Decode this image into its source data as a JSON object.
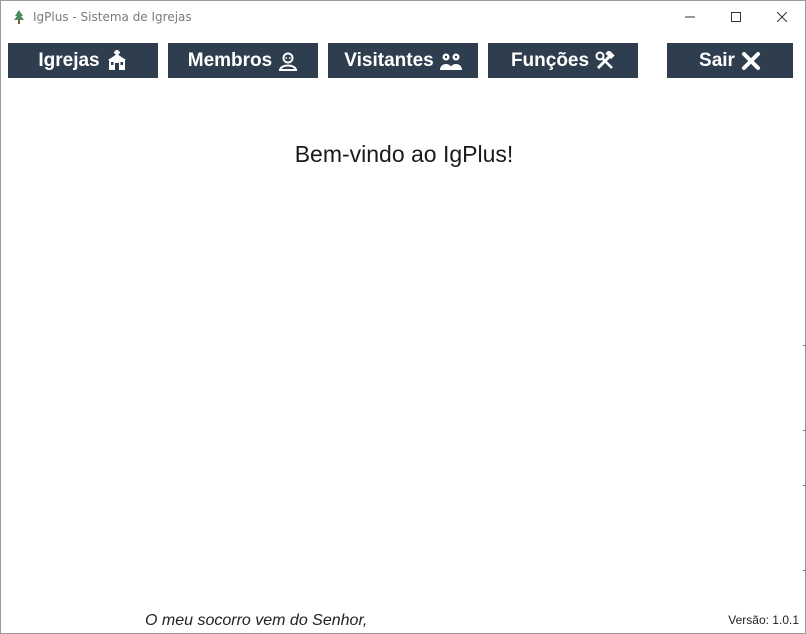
{
  "window": {
    "title": "IgPlus - Sistema de Igrejas",
    "app_icon": "tree-icon",
    "controls": [
      "minimize-icon",
      "maximize-icon",
      "close-icon"
    ]
  },
  "toolbar": {
    "igrejas_label": "Igrejas",
    "igrejas_icon": "church-icon",
    "membros_label": "Membros",
    "membros_icon": "person-icon",
    "visitantes_label": "Visitantes",
    "visitantes_icon": "people-icon",
    "funcoes_label": "Funções",
    "funcoes_icon": "tools-icon",
    "sair_label": "Sair",
    "sair_icon": "x-icon",
    "button_color": "#2e3e4e",
    "button_text_color": "#ffffff"
  },
  "main": {
    "welcome_text": "Bem-vindo ao IgPlus!"
  },
  "footer": {
    "motto": "O meu socorro vem do Senhor,",
    "version": "Versão: 1.0.1"
  }
}
